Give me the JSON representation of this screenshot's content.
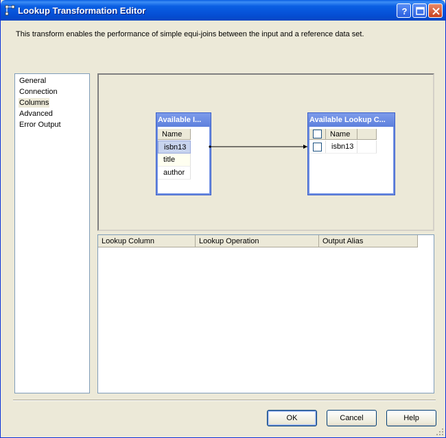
{
  "window": {
    "title": "Lookup Transformation Editor",
    "description": "This transform enables the performance of simple equi-joins between the input and a reference data set."
  },
  "nav": {
    "items": [
      "General",
      "Connection",
      "Columns",
      "Advanced",
      "Error Output"
    ],
    "selected": "Columns"
  },
  "input_table": {
    "header": "Available I...",
    "column_header": "Name",
    "rows": [
      "isbn13",
      "title",
      "author"
    ]
  },
  "lookup_table": {
    "header": "Available Lookup C...",
    "column_header": "Name",
    "rows": [
      "isbn13"
    ]
  },
  "grid": {
    "columns": [
      "Lookup Column",
      "Lookup Operation",
      "Output Alias"
    ]
  },
  "buttons": {
    "ok": "OK",
    "cancel": "Cancel",
    "help": "Help"
  },
  "icons": {
    "title": "transform-icon",
    "help": "question-icon",
    "maximize": "maximize-icon",
    "close": "close-icon"
  },
  "colors": {
    "title_bar": "#0a5fe3",
    "table_header": "#6f8fe3",
    "selection": "#c8d4ee"
  }
}
